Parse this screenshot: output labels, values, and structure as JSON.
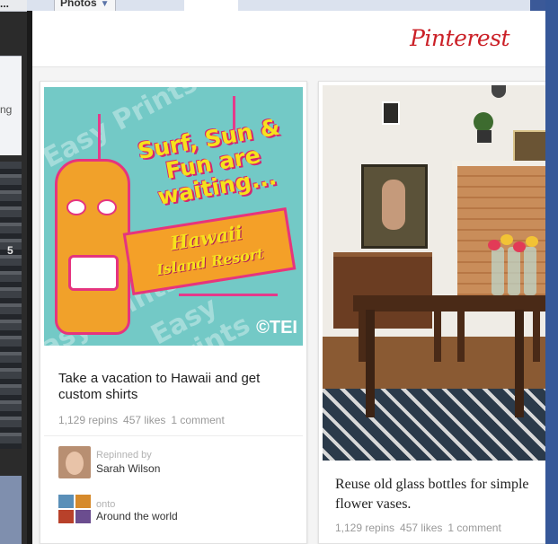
{
  "background": {
    "top_left_text": "...",
    "dropdown_label": "Photos",
    "side_text": "ng",
    "photo_digit": "5"
  },
  "pinterest": {
    "logo": "Pinterest",
    "accent_color": "#cb2027"
  },
  "pins": [
    {
      "image_text": {
        "headline": "Surf, Sun & Fun are waiting...",
        "banner_line1": "Hawaii",
        "banner_line2": "Island Resort",
        "watermark": "Easy Prints",
        "brand": "©TEI"
      },
      "description": "Take a vacation to Hawaii and get custom shirts",
      "repins": "1,129 repins",
      "likes": "457 likes",
      "comments": "1 comment",
      "repinned_label": "Repinned by",
      "repinned_by": "Sarah Wilson",
      "onto_label": "onto",
      "board": "Around the world"
    },
    {
      "description": "Reuse old glass bottles for simple flower vases.",
      "repins": "1,129 repins",
      "likes": "457 likes",
      "comments": "1 comment"
    }
  ]
}
